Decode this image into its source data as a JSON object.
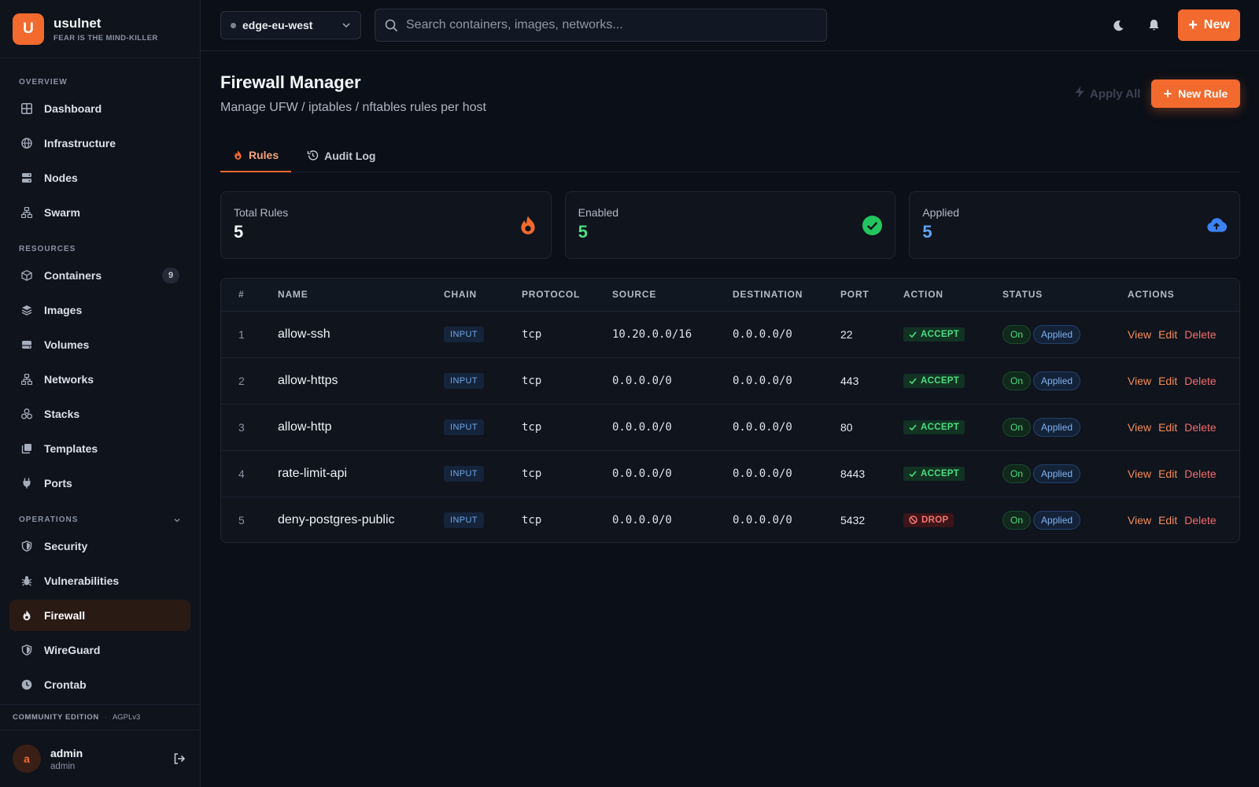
{
  "brand": {
    "logo_letter": "U",
    "name": "usulnet",
    "tagline": "FEAR IS THE MIND-KILLER"
  },
  "sidebar": {
    "sections": [
      {
        "title": "OVERVIEW",
        "items": [
          {
            "label": "Dashboard",
            "icon": "dashboard-icon"
          },
          {
            "label": "Infrastructure",
            "icon": "globe-icon"
          },
          {
            "label": "Nodes",
            "icon": "server-icon"
          },
          {
            "label": "Swarm",
            "icon": "network-icon"
          }
        ]
      },
      {
        "title": "RESOURCES",
        "items": [
          {
            "label": "Containers",
            "icon": "cube-icon",
            "badge": "9"
          },
          {
            "label": "Images",
            "icon": "layers-icon"
          },
          {
            "label": "Volumes",
            "icon": "hard-drive-icon"
          },
          {
            "label": "Networks",
            "icon": "network-icon"
          },
          {
            "label": "Stacks",
            "icon": "cubes-icon"
          },
          {
            "label": "Templates",
            "icon": "copy-icon"
          },
          {
            "label": "Ports",
            "icon": "plug-icon"
          }
        ]
      },
      {
        "title": "OPERATIONS",
        "items": [
          {
            "label": "Security",
            "icon": "shield-icon"
          },
          {
            "label": "Vulnerabilities",
            "icon": "bug-icon"
          },
          {
            "label": "Firewall",
            "icon": "fire-icon",
            "active": true
          },
          {
            "label": "WireGuard",
            "icon": "shield-icon"
          },
          {
            "label": "Crontab",
            "icon": "clock-icon"
          }
        ]
      }
    ],
    "edition": "COMMUNITY EDITION",
    "license": "AGPLv3",
    "user": {
      "initial": "a",
      "name": "admin",
      "role": "admin"
    }
  },
  "topbar": {
    "host": "edge-eu-west",
    "search_placeholder": "Search containers, images, networks...",
    "new_label": "New"
  },
  "page": {
    "title": "Firewall Manager",
    "subtitle": "Manage UFW / iptables / nftables rules per host",
    "apply_all_label": "Apply All",
    "new_rule_label": "New Rule",
    "tabs": [
      {
        "label": "Rules",
        "active": true
      },
      {
        "label": "Audit Log"
      }
    ]
  },
  "stats": [
    {
      "label": "Total Rules",
      "value": "5",
      "color": "#f5f7fa",
      "icon": "fire-icon",
      "icon_color": "#f26a2e"
    },
    {
      "label": "Enabled",
      "value": "5",
      "color": "#4ade80",
      "icon": "check-circle-icon",
      "icon_color": "#22c55e"
    },
    {
      "label": "Applied",
      "value": "5",
      "color": "#60a5fa",
      "icon": "cloud-upload-icon",
      "icon_color": "#3b82f6"
    }
  ],
  "table": {
    "headers": [
      "#",
      "NAME",
      "CHAIN",
      "PROTOCOL",
      "SOURCE",
      "DESTINATION",
      "PORT",
      "ACTION",
      "STATUS",
      "ACTIONS"
    ],
    "rows": [
      {
        "num": "1",
        "name": "allow-ssh",
        "chain": "INPUT",
        "protocol": "tcp",
        "source": "10.20.0.0/16",
        "destination": "0.0.0.0/0",
        "port": "22",
        "action": "ACCEPT",
        "enabled": "On",
        "applied": "Applied"
      },
      {
        "num": "2",
        "name": "allow-https",
        "chain": "INPUT",
        "protocol": "tcp",
        "source": "0.0.0.0/0",
        "destination": "0.0.0.0/0",
        "port": "443",
        "action": "ACCEPT",
        "enabled": "On",
        "applied": "Applied"
      },
      {
        "num": "3",
        "name": "allow-http",
        "chain": "INPUT",
        "protocol": "tcp",
        "source": "0.0.0.0/0",
        "destination": "0.0.0.0/0",
        "port": "80",
        "action": "ACCEPT",
        "enabled": "On",
        "applied": "Applied"
      },
      {
        "num": "4",
        "name": "rate-limit-api",
        "chain": "INPUT",
        "protocol": "tcp",
        "source": "0.0.0.0/0",
        "destination": "0.0.0.0/0",
        "port": "8443",
        "action": "ACCEPT",
        "enabled": "On",
        "applied": "Applied"
      },
      {
        "num": "5",
        "name": "deny-postgres-public",
        "chain": "INPUT",
        "protocol": "tcp",
        "source": "0.0.0.0/0",
        "destination": "0.0.0.0/0",
        "port": "5432",
        "action": "DROP",
        "enabled": "On",
        "applied": "Applied"
      }
    ],
    "row_actions": {
      "view": "View",
      "edit": "Edit",
      "delete": "Delete"
    }
  },
  "colors": {
    "accent": "#f26a2e",
    "background": "#0b0f17",
    "sidebar": "#0e131c"
  }
}
